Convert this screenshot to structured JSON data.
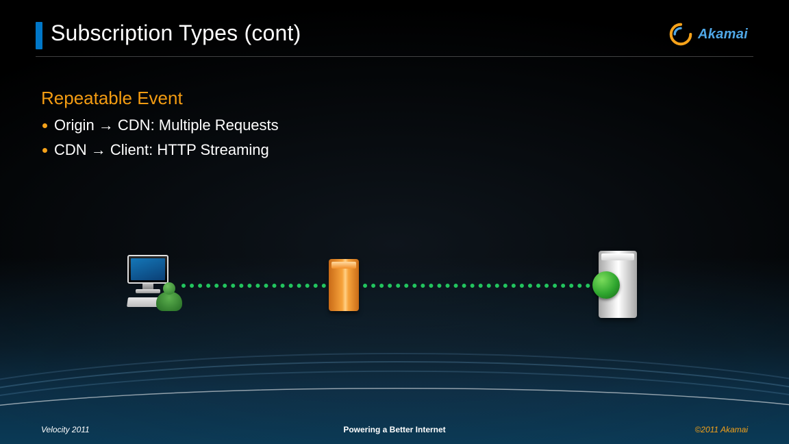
{
  "slide": {
    "title": "Subscription Types (cont)",
    "subheading": "Repeatable Event",
    "bullets": [
      "Origin → CDN: Multiple Requests",
      "CDN → Client: HTTP Streaming"
    ]
  },
  "brand": {
    "company": "Akamai",
    "accent_color": "#f5a21a",
    "logo_blue": "#4fa7e6"
  },
  "diagram": {
    "nodes": [
      "client",
      "cdn",
      "origin"
    ],
    "connector_color": "#22c55e"
  },
  "footer": {
    "left": "Velocity 2011",
    "center": "Powering a Better Internet",
    "right": "©2011 Akamai"
  }
}
